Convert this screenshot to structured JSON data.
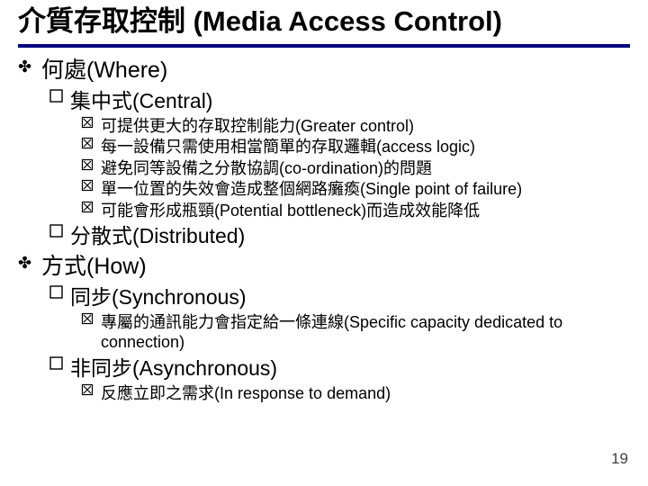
{
  "title": "介質存取控制 (Media Access Control)",
  "bullets": {
    "l1a": "何處(Where)",
    "l2a": "集中式(Central)",
    "l3a": "可提供更大的存取控制能力(Greater control)",
    "l3b": "每一設備只需使用相當簡單的存取邏輯(access logic)",
    "l3c": "避免同等設備之分散協調(co-ordination)的問題",
    "l3d": "單一位置的失效會造成整個網路癱瘓(Single point of failure)",
    "l3e": "可能會形成瓶頸(Potential bottleneck)而造成效能降低",
    "l2b": "分散式(Distributed)",
    "l1b": "方式(How)",
    "l2c": "同步(Synchronous)",
    "l3f": "專屬的通訊能力會指定給一條連線(Specific capacity dedicated to connection)",
    "l2d": "非同步(Asynchronous)",
    "l3g": "反應立即之需求(In response to demand)"
  },
  "page_number": "19"
}
